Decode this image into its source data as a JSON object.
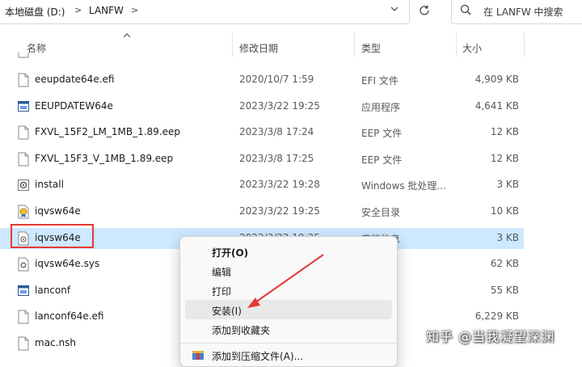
{
  "address_bar": {
    "crumbs": [
      "本地磁盘 (D:)",
      "LANFW"
    ],
    "separator": ">",
    "dropdown_icon": "chevron-down-icon",
    "refresh_icon": "refresh-icon"
  },
  "search": {
    "placeholder": "在 LANFW 中搜索",
    "icon": "search-icon"
  },
  "columns": {
    "name": "名称",
    "date": "修改日期",
    "type": "类型",
    "size": "大小"
  },
  "rows": [
    {
      "name": "eeupdate64e.efi",
      "date": "2020/10/7 1:59",
      "type": "EFI 文件",
      "size": "4,909 KB",
      "icon": "file-icon"
    },
    {
      "name": "EEUPDATEW64e",
      "date": "2023/3/22 19:25",
      "type": "应用程序",
      "size": "4,641 KB",
      "icon": "app-icon"
    },
    {
      "name": "FXVL_15F2_LM_1MB_1.89.eep",
      "date": "2023/3/8 17:24",
      "type": "EEP 文件",
      "size": "12 KB",
      "icon": "file-icon"
    },
    {
      "name": "FXVL_15F3_V_1MB_1.89.eep",
      "date": "2023/3/8 17:25",
      "type": "EEP 文件",
      "size": "12 KB",
      "icon": "file-icon"
    },
    {
      "name": "install",
      "date": "2023/3/22 19:28",
      "type": "Windows 批处理...",
      "size": "3 KB",
      "icon": "batch-icon"
    },
    {
      "name": "iqvsw64e",
      "date": "2023/3/22 19:25",
      "type": "安全目录",
      "size": "10 KB",
      "icon": "catalog-icon"
    },
    {
      "name": "iqvsw64e",
      "date": "2023/3/22 19:25",
      "type": "安装信息",
      "size": "3 KB",
      "icon": "setup-info-icon",
      "selected": true
    },
    {
      "name": "iqvsw64e.sys",
      "date": "",
      "type": "",
      "size": "62 KB",
      "icon": "sys-file-icon"
    },
    {
      "name": "lanconf",
      "date": "",
      "type": "序",
      "size": "55 KB",
      "icon": "app-icon"
    },
    {
      "name": "lanconf64e.efi",
      "date": "",
      "type": "",
      "size": "6,229 KB",
      "icon": "file-icon"
    },
    {
      "name": "mac.nsh",
      "date": "",
      "type": "",
      "size": "",
      "icon": "file-icon"
    }
  ],
  "context_menu": {
    "items": [
      {
        "label": "打开(O)",
        "bold": true
      },
      {
        "label": "编辑"
      },
      {
        "label": "打印"
      },
      {
        "label": "安装(I)",
        "hover": true
      },
      {
        "label": "添加到收藏夹"
      },
      {
        "label": "添加到压缩文件(A)...",
        "icon": "archive-icon"
      }
    ]
  },
  "colors": {
    "selection": "#cde8ff",
    "annotation": "#e53935"
  },
  "watermark": "知乎 @当我凝望深渊"
}
